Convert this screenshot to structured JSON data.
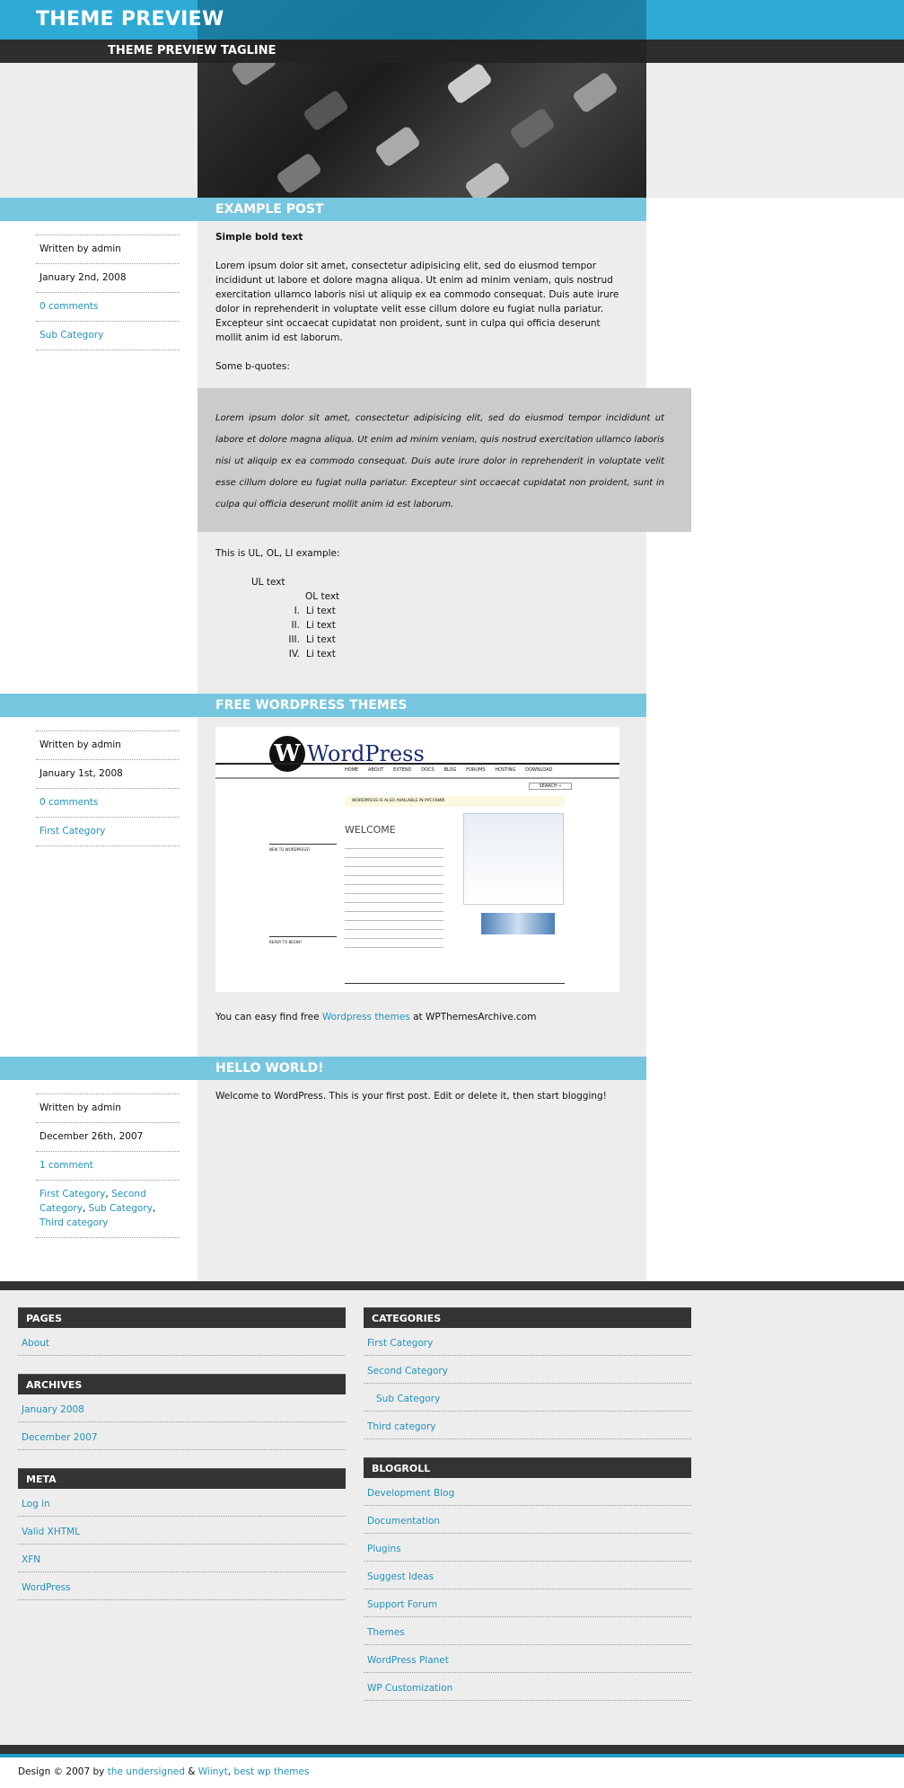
{
  "site": {
    "title": "THEME PREVIEW",
    "tagline": "THEME PREVIEW TAGLINE"
  },
  "colors": {
    "header": "#2eaad6",
    "post_bar": "#76c6df",
    "link": "#2292bb",
    "dark": "#333333",
    "content_bg": "#ededed",
    "blockquote_bg": "#cbcbcb"
  },
  "posts": [
    {
      "title": "EXAMPLE POST",
      "meta": {
        "author": "Written by admin",
        "date": "January 2nd, 2008",
        "comments": "0 comments",
        "categories": [
          "Sub Category"
        ]
      },
      "bold": "Simple bold text",
      "para": "Lorem ipsum dolor sit amet, consectetur adipisicing elit, sed do eiusmod tempor incididunt ut labore et dolore magna aliqua. Ut enim ad minim veniam, quis nostrud exercitation ullamco laboris nisi ut aliquip ex ea commodo consequat. Duis aute irure dolor in reprehenderit in voluptate velit esse cillum dolore eu fugiat nulla pariatur. Excepteur sint occaecat cupidatat non proident, sunt in culpa qui officia deserunt mollit anim id est laborum.",
      "bquote_intro": "Some b-quotes:",
      "bquote": "Lorem ipsum dolor sit amet, consectetur adipisicing elit, sed do eiusmod tempor incididunt ut labore et dolore magna aliqua. Ut enim ad minim veniam, quis nostrud exercitation ullamco laboris nisi ut aliquip ex ea commodo consequat. Duis aute irure dolor in reprehenderit in voluptate velit esse cillum dolore eu fugiat nulla pariatur. Excepteur sint occaecat cupidatat non proident, sunt in culpa qui officia deserunt mollit anim id est laborum.",
      "list_intro": "This is UL, OL, LI example:",
      "ul_text": "UL text",
      "ol_text": "OL text",
      "li": [
        {
          "num": "I.",
          "text": "Li text"
        },
        {
          "num": "II.",
          "text": "Li text"
        },
        {
          "num": "III.",
          "text": "Li text"
        },
        {
          "num": "IV.",
          "text": "Li text"
        }
      ]
    },
    {
      "title": "FREE WORDPRESS THEMES",
      "meta": {
        "author": "Written by admin",
        "date": "January 1st, 2008",
        "comments": "0 comments",
        "categories": [
          "First Category"
        ]
      },
      "text_before": "You can easy find free ",
      "link": "Wordpress themes",
      "text_after": " at WPThemesArchive.com",
      "screenshot": {
        "logo": "WordPress",
        "nav": [
          "HOME",
          "ABOUT",
          "EXTEND",
          "DOCS",
          "BLOG",
          "FORUMS",
          "HOSTING",
          "DOWNLOAD"
        ],
        "search": "SEARCH »",
        "notice": "WORDPRESS IS ALSO AVAILABLE IN РУССКИЙ.",
        "welcome": "WELCOME",
        "new_heading": "NEW TO WORDPRESS?",
        "begin_heading": "READY TO BEGIN?"
      }
    },
    {
      "title": "HELLO WORLD!",
      "meta": {
        "author": "Written by admin",
        "date": "December 26th, 2007",
        "comments": "1 comment",
        "categories": [
          "First Category",
          "Second Category",
          "Sub Category",
          "Third category"
        ]
      },
      "text": "Welcome to WordPress. This is your first post. Edit or delete it, then start blogging!"
    }
  ],
  "widgets": {
    "pages": {
      "title": "PAGES",
      "items": [
        "About"
      ]
    },
    "archives": {
      "title": "ARCHIVES",
      "items": [
        "January 2008",
        "December 2007"
      ]
    },
    "meta": {
      "title": "META",
      "items": [
        "Log in",
        "Valid XHTML",
        "XFN",
        "WordPress"
      ]
    },
    "categories": {
      "title": "CATEGORIES",
      "items": [
        "First Category",
        "Second Category",
        "Sub Category",
        "Third category"
      ]
    },
    "blogroll": {
      "title": "BLOGROLL",
      "items": [
        "Development Blog",
        "Documentation",
        "Plugins",
        "Suggest Ideas",
        "Support Forum",
        "Themes",
        "WordPress Planet",
        "WP Customization"
      ]
    }
  },
  "footer": {
    "prefix": "Design © 2007 by ",
    "link1": "the undersigned",
    "sep": " & ",
    "link2": "Wiinyt",
    "comma": ", ",
    "link3": "best wp themes"
  }
}
